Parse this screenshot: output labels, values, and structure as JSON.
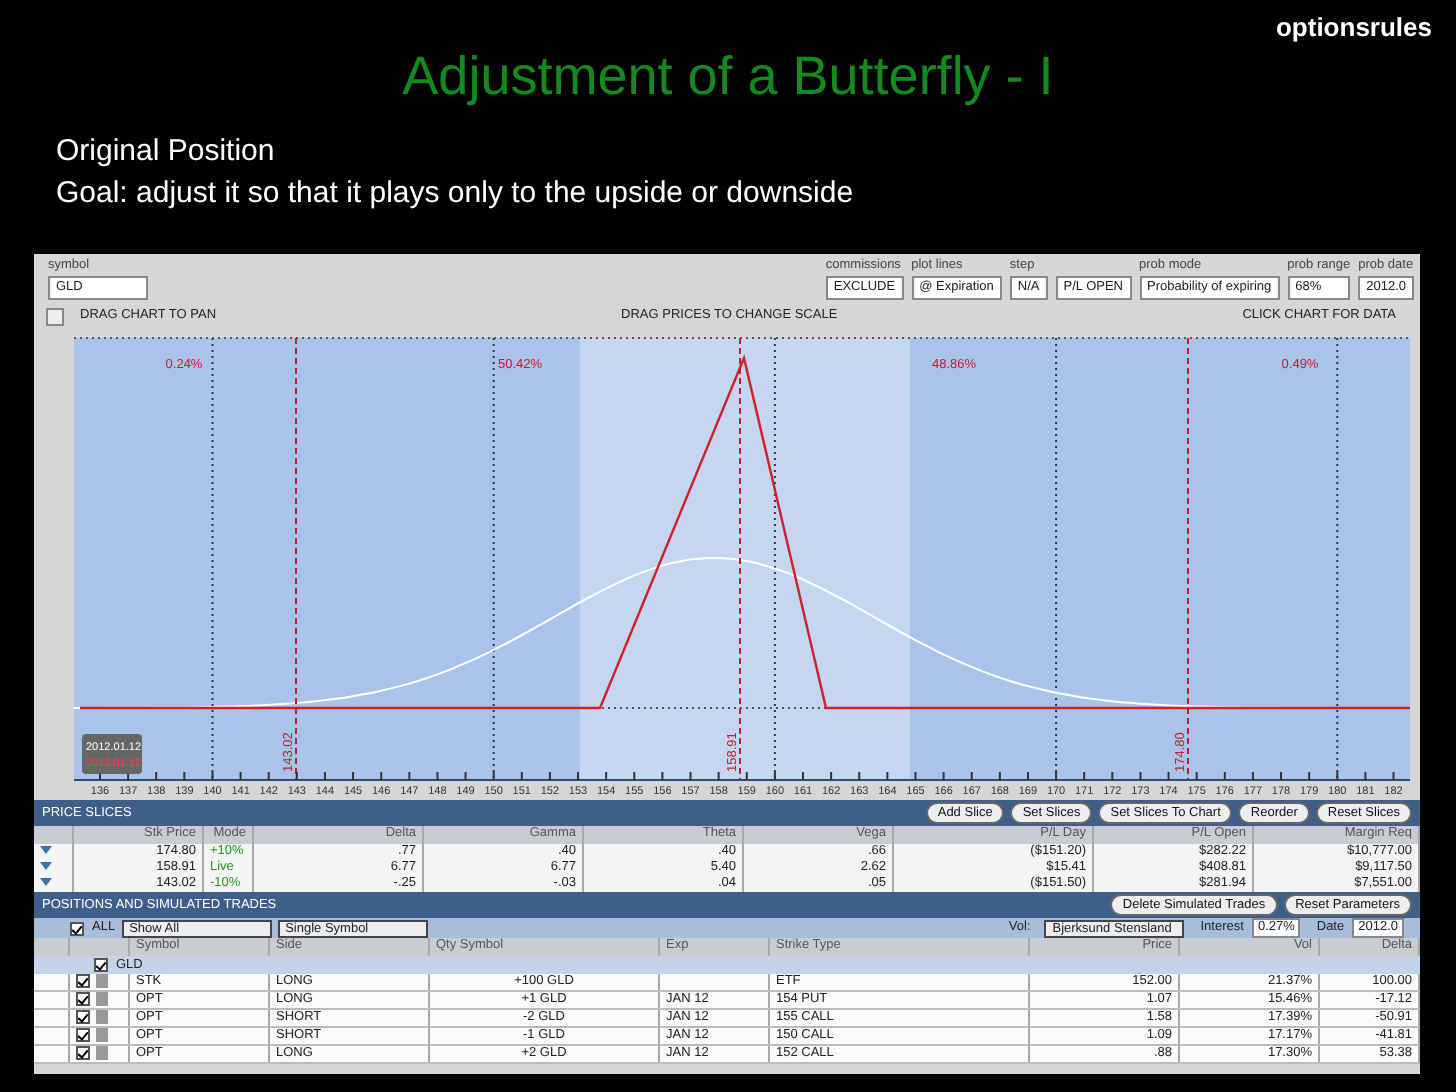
{
  "slide": {
    "title": "Adjustment of a Butterfly - I",
    "logo": "optionsrules",
    "lines": [
      "Original Position",
      "Goal: adjust it so that it plays only to the upside or downside"
    ]
  },
  "toolbar": {
    "symbol_label": "symbol",
    "symbol": "GLD",
    "fields": [
      {
        "label": "commissions",
        "value": "EXCLUDE"
      },
      {
        "label": "plot lines",
        "value": "@ Expiration"
      },
      {
        "label": "step",
        "value": "N/A"
      },
      {
        "value": "P/L OPEN"
      },
      {
        "label": "prob mode",
        "value": "Probability of expiring"
      },
      {
        "label": "prob range",
        "value": "68%"
      },
      {
        "label": "prob date",
        "value": "2012.0"
      }
    ]
  },
  "hints": [
    "DRAG CHART TO PAN",
    "DRAG PRICES TO CHANGE SCALE",
    "CLICK CHART FOR DATA"
  ],
  "chart": {
    "probabilities": [
      "0.24%",
      "50.42%",
      "48.86%",
      "0.49%"
    ],
    "slice_labels": [
      "143.02",
      "158.91",
      "174.80"
    ],
    "date_labels": [
      "2012.01.12",
      "2012.01.12"
    ],
    "x_labels": [
      "136",
      "137",
      "138",
      "139",
      "140",
      "141",
      "142",
      "143",
      "144",
      "145",
      "146",
      "147",
      "148",
      "149",
      "150",
      "151",
      "152",
      "153",
      "154",
      "155",
      "156",
      "157",
      "158",
      "159",
      "160",
      "161",
      "162",
      "163",
      "164",
      "165",
      "166",
      "167",
      "168",
      "169",
      "170",
      "171",
      "172",
      "173",
      "174",
      "175",
      "176",
      "177",
      "178",
      "179",
      "180",
      "181",
      "182"
    ]
  },
  "price_slices": {
    "title": "PRICE SLICES",
    "buttons": [
      "Add Slice",
      "Set Slices",
      "Set Slices To Chart",
      "Reorder",
      "Reset Slices"
    ],
    "columns": [
      "Stk Price",
      "Mode",
      "Delta",
      "Gamma",
      "Theta",
      "Vega",
      "P/L Day",
      "P/L Open",
      "Margin Req"
    ],
    "rows": [
      [
        "174.80",
        "+10%",
        ".77",
        ".40",
        ".40",
        ".66",
        "($151.20)",
        "$282.22",
        "$10,777.00"
      ],
      [
        "158.91",
        "Live",
        "6.77",
        "6.77",
        "5.40",
        "2.62",
        "$15.41",
        "$408.81",
        "$9,117.50"
      ],
      [
        "143.02",
        "-10%",
        "-.25",
        "-.03",
        ".04",
        ".05",
        "($151.50)",
        "$281.94",
        "$7,551.00"
      ]
    ]
  },
  "positions": {
    "title": "POSITIONS AND SIMULATED TRADES",
    "buttons": [
      "Delete Simulated Trades",
      "Reset Parameters"
    ],
    "all": {
      "label": "ALL",
      "checked": true
    },
    "filters": [
      "Show All",
      "Single Symbol"
    ],
    "vol_label": "Vol:",
    "vol": "Bjerksund Stensland",
    "interest_label": "Interest",
    "interest": "0.27%",
    "date_label": "Date",
    "date": "2012.0",
    "columns": [
      "Symbol",
      "Side",
      "Qty Symbol",
      "Exp",
      "Strike Type",
      "Price",
      "Vol",
      "Delta"
    ],
    "group": {
      "symbol": "GLD",
      "checked": true
    },
    "rows": [
      {
        "checked": true,
        "cells": [
          "STK",
          "LONG",
          "+100 GLD",
          "",
          "ETF",
          "152.00",
          "21.37%",
          "100.00"
        ]
      },
      {
        "checked": true,
        "cells": [
          "OPT",
          "LONG",
          "+1 GLD",
          "JAN 12",
          "154 PUT",
          "1.07",
          "15.46%",
          "-17.12"
        ]
      },
      {
        "checked": true,
        "cells": [
          "OPT",
          "SHORT",
          "-2 GLD",
          "JAN 12",
          "155 CALL",
          "1.58",
          "17.39%",
          "-50.91"
        ]
      },
      {
        "checked": true,
        "cells": [
          "OPT",
          "SHORT",
          "-1 GLD",
          "JAN 12",
          "150 CALL",
          "1.09",
          "17.17%",
          "-41.81"
        ]
      },
      {
        "checked": true,
        "cells": [
          "OPT",
          "LONG",
          "+2 GLD",
          "JAN 12",
          "152 CALL",
          ".88",
          "17.30%",
          "53.38"
        ]
      }
    ]
  }
}
